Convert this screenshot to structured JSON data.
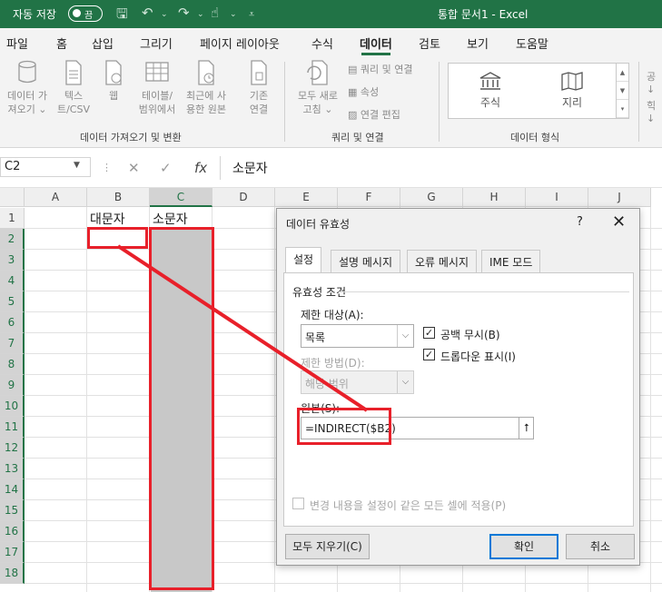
{
  "titlebar": {
    "autosave_label": "자동 저장",
    "autosave_state": "끔",
    "doc_title": "통합 문서1  -  Excel"
  },
  "ribbon_tabs": [
    "파일",
    "홈",
    "삽입",
    "그리기",
    "페이지 레이아웃",
    "수식",
    "데이터",
    "검토",
    "보기",
    "도움말"
  ],
  "active_tab": "데이터",
  "ribbon": {
    "get_data": [
      "데이터 가",
      "져오기 ⌄"
    ],
    "text_csv": [
      "텍스",
      "트/CSV"
    ],
    "web": [
      "웹"
    ],
    "table_range": [
      "테이블/",
      "범위에서"
    ],
    "recent": [
      "최근에 사",
      "용한 원본"
    ],
    "existing": [
      "기존",
      "연결"
    ],
    "group1_label": "데이터 가져오기 및 변환",
    "refresh_all": [
      "모두 새로",
      "고침 ⌄"
    ],
    "queries_connections": "쿼리 및 연결",
    "properties": "속성",
    "edit_links": "연결 편집",
    "group2_label": "쿼리 및 연결",
    "stocks": "주식",
    "geography": "지리",
    "group3_label": "데이터 형식",
    "edge_icons": [
      "공↓",
      "힉↓"
    ]
  },
  "formula_bar": {
    "name_box": "C2",
    "formula": "소문자"
  },
  "columns": [
    "A",
    "B",
    "C",
    "D",
    "E",
    "F",
    "G",
    "H",
    "I",
    "J"
  ],
  "rows": [
    "1",
    "2",
    "3",
    "4",
    "5",
    "6",
    "7",
    "8",
    "9",
    "10",
    "11",
    "12",
    "13",
    "14",
    "15",
    "16",
    "17",
    "18"
  ],
  "cells": {
    "B1": "대문자",
    "C1": "소문자"
  },
  "dialog": {
    "title": "데이터 유효성",
    "help": "?",
    "tabs": [
      "설정",
      "설명 메시지",
      "오류 메시지",
      "IME 모드"
    ],
    "criteria_label": "유효성 조건",
    "allow_label": "제한 대상(A):",
    "allow_value": "목록",
    "ignore_blank": "공백 무시(B)",
    "dropdown": "드롭다운 표시(I)",
    "data_label": "제한 방법(D):",
    "data_value": "해당 범위",
    "source_label": "원본(S):",
    "source_value": "=INDIRECT($B2)",
    "apply_all": "변경 내용을 설정이 같은 모든 셀에 적용(P)",
    "clear_all": "모두 지우기(C)",
    "ok": "확인",
    "cancel": "취소"
  },
  "colors": {
    "excel_green": "#217346",
    "annotation_red": "#e8202a",
    "ok_border": "#0078d7"
  }
}
